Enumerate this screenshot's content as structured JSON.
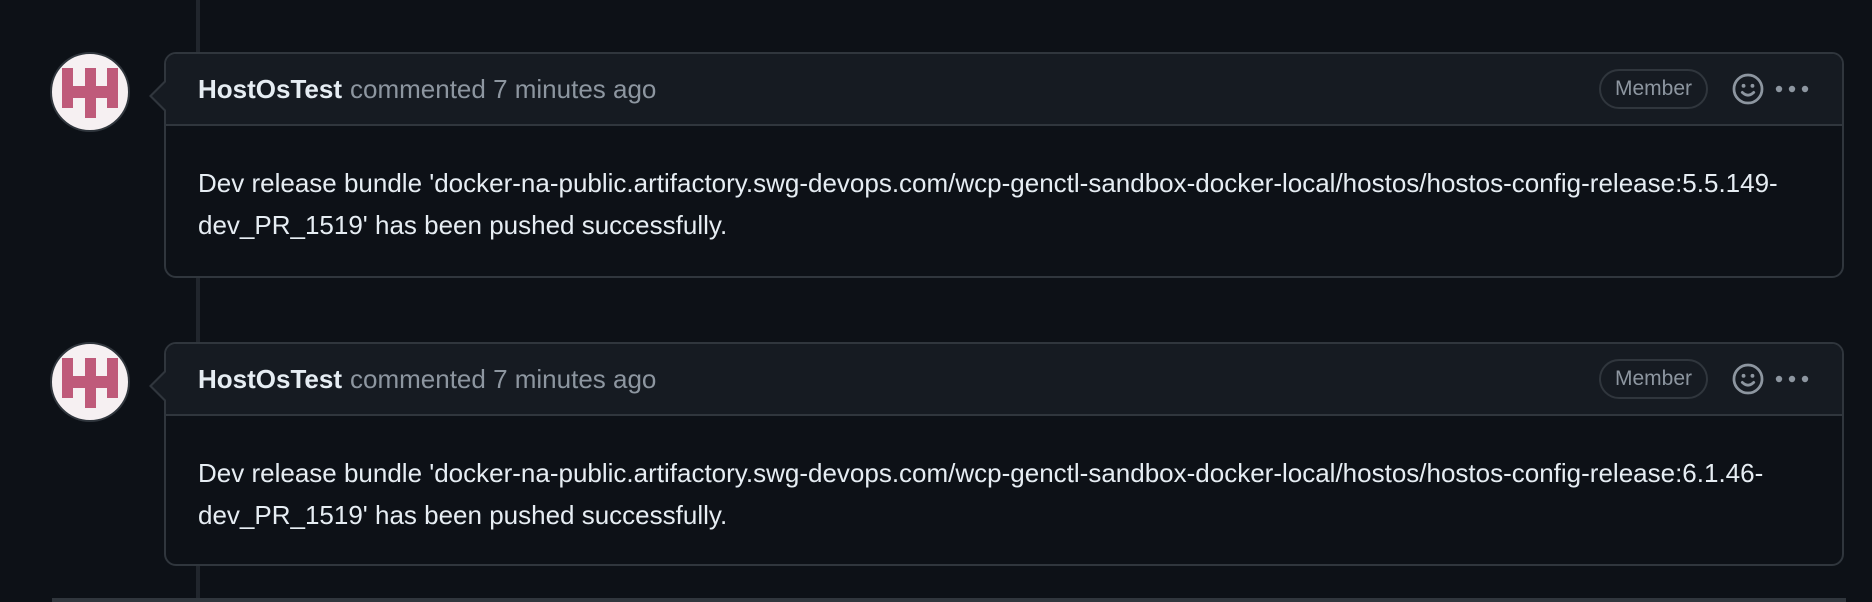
{
  "comments": [
    {
      "author": "HostOsTest",
      "meta": "commented 7 minutes ago",
      "badge": "Member",
      "body": "Dev release bundle 'docker-na-public.artifactory.swg-devops.com/wcp-genctl-sandbox-docker-local/hostos/hostos-config-release:5.5.149-dev_PR_1519' has been pushed successfully."
    },
    {
      "author": "HostOsTest",
      "meta": "commented 7 minutes ago",
      "badge": "Member",
      "body": "Dev release bundle 'docker-na-public.artifactory.swg-devops.com/wcp-genctl-sandbox-docker-local/hostos/hostos-config-release:6.1.46-dev_PR_1519' has been pushed successfully."
    }
  ],
  "icons": {
    "avatar": "identicon-avatar",
    "reaction": "smiley-icon",
    "more": "kebab-horizontal-icon"
  },
  "colors": {
    "background": "#0d1117",
    "header_background": "#161b22",
    "border": "#30363d",
    "avatar_accent": "#bf5a7a",
    "muted_text": "#8d96a0"
  }
}
